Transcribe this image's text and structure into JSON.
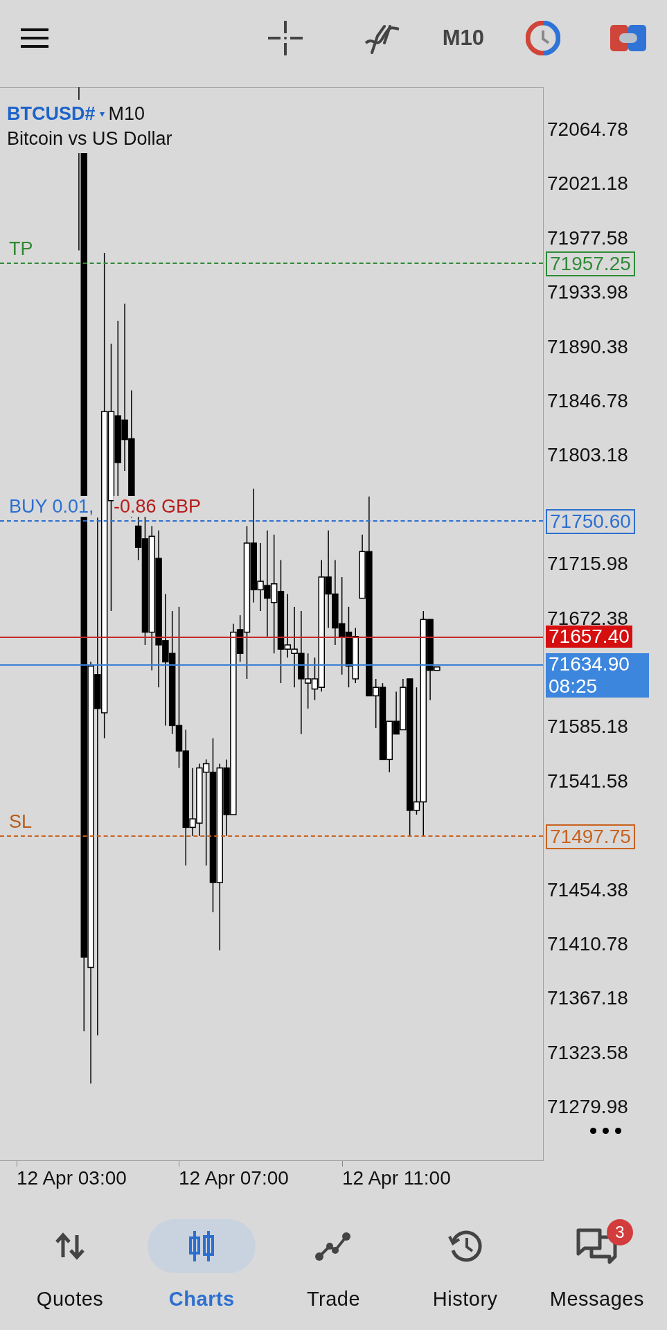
{
  "toolbar": {
    "timeframe": "M10"
  },
  "chart": {
    "symbol": "BTCUSD#",
    "caret": "▾",
    "timeframe": "M10",
    "description": "Bitcoin vs US Dollar",
    "price_labels": [
      "72064.78",
      "72021.18",
      "71977.58",
      "71933.98",
      "71890.38",
      "71846.78",
      "71803.18",
      "71715.98",
      "71672.38",
      "71585.18",
      "71541.58",
      "71454.38",
      "71410.78",
      "71367.18",
      "71323.58",
      "71279.98"
    ],
    "levels": [
      {
        "kind": "tp",
        "label": "TP",
        "price": "71957.25"
      },
      {
        "kind": "order",
        "label": "BUY 0.01,",
        "profit": "-0.86 GBP",
        "price": "71750.60"
      },
      {
        "kind": "bid",
        "price": "71657.40"
      },
      {
        "kind": "ask",
        "price": "71634.90",
        "timer": "08:25"
      },
      {
        "kind": "sl",
        "label": "SL",
        "price": "71497.75"
      }
    ],
    "time_labels": [
      "12 Apr 03:00",
      "12 Apr 07:00",
      "12 Apr 11:00"
    ]
  },
  "nav": [
    {
      "label": "Quotes",
      "selected": false
    },
    {
      "label": "Charts",
      "selected": true
    },
    {
      "label": "Trade",
      "selected": false
    },
    {
      "label": "History",
      "selected": false
    },
    {
      "label": "Messages",
      "selected": false,
      "badge": "3"
    }
  ]
}
